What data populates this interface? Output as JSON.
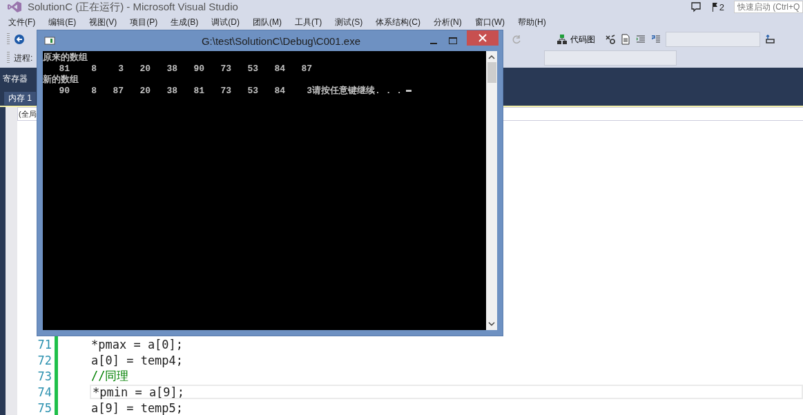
{
  "ide": {
    "title": "SolutionC (正在运行) - Microsoft Visual Studio",
    "notification_count": "2",
    "quick_launch": {
      "placeholder": "快速启动 (Ctrl+Q"
    },
    "menu": [
      "文件(F)",
      "编辑(E)",
      "视图(V)",
      "项目(P)",
      "生成(B)",
      "调试(D)",
      "团队(M)",
      "工具(T)",
      "测试(S)",
      "体系结构(C)",
      "分析(N)",
      "窗口(W)",
      "帮助(H)"
    ],
    "toolbar": {
      "code_map": "代码图",
      "process_label": "进程:"
    },
    "panel_tab": "寄存器",
    "memory_tab": "内存 1",
    "scope_field": "(全局",
    "editor": {
      "lines": [
        {
          "number": "71",
          "code": "*pmax = a[0];",
          "kind": "code",
          "current": false
        },
        {
          "number": "72",
          "code": "a[0] = temp4;",
          "kind": "code",
          "current": false
        },
        {
          "number": "73",
          "code": "//同理",
          "kind": "comment",
          "current": false
        },
        {
          "number": "74",
          "code": "*pmin = a[9];",
          "kind": "code",
          "current": true
        },
        {
          "number": "75",
          "code": "a[9] = temp5;",
          "kind": "code",
          "current": false
        }
      ]
    }
  },
  "console": {
    "title": "G:\\test\\SolutionC\\Debug\\C001.exe",
    "lines": [
      "原来的数组",
      "   81    8    3   20   38   90   73   53   84   87",
      "新的数组",
      "   90    8   87   20   38   81   73   53   84    3请按任意键继续. . ."
    ]
  }
}
